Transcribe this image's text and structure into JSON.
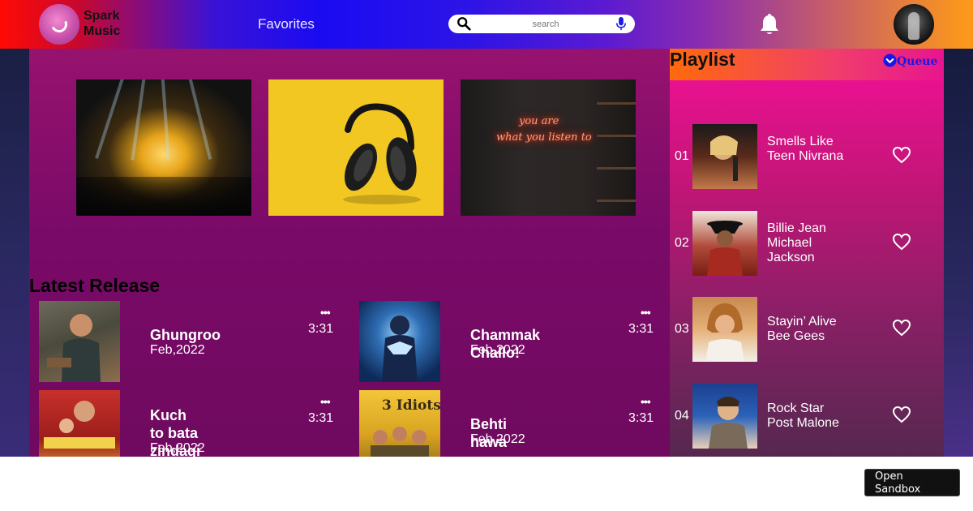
{
  "header": {
    "logo_line1": "Spark",
    "logo_line2": "Music",
    "nav_favorites": "Favorites",
    "search_placeholder": "search"
  },
  "banners": [
    {
      "icon": "concert-image"
    },
    {
      "icon": "headphones-image"
    },
    {
      "icon": "neon-sign-image",
      "neon_line1": "you are",
      "neon_line2": "what you listen to"
    }
  ],
  "latest": {
    "title": "Latest Release",
    "songs": [
      {
        "name": "Ghungroo",
        "date": "Feb,2022",
        "duration": "3:31",
        "more": "•••"
      },
      {
        "name": "Chammak Challo!",
        "date": "Feb,2022",
        "duration": "3:31",
        "more": "•••"
      },
      {
        "name": "Kuch to bata zindagi",
        "date": "Feb,2022",
        "duration": "3:31",
        "more": "•••"
      },
      {
        "name": "Behti hawa sa",
        "date": "Feb,2022",
        "duration": "3:31",
        "more": "•••"
      }
    ]
  },
  "playlist": {
    "title": "Playlist",
    "queue_label": "Queue",
    "tracks": [
      {
        "num": "01",
        "title": "Smells Like Teen Nivrana"
      },
      {
        "num": "02",
        "title": "Billie Jean Michael Jackson"
      },
      {
        "num": "03",
        "title": "Stayin’ Alive Bee Gees"
      },
      {
        "num": "04",
        "title": "Rock Star Post Malone"
      }
    ]
  },
  "footer": {
    "sandbox_label": "Open Sandbox"
  },
  "colors": {
    "header_start": "#ff0a05",
    "header_mid": "#1a0bf2",
    "header_end": "#ff9b17",
    "main_bg": "#7a0a68",
    "playlist_bg": "#e8118f",
    "queue_color": "#1a17e6"
  }
}
